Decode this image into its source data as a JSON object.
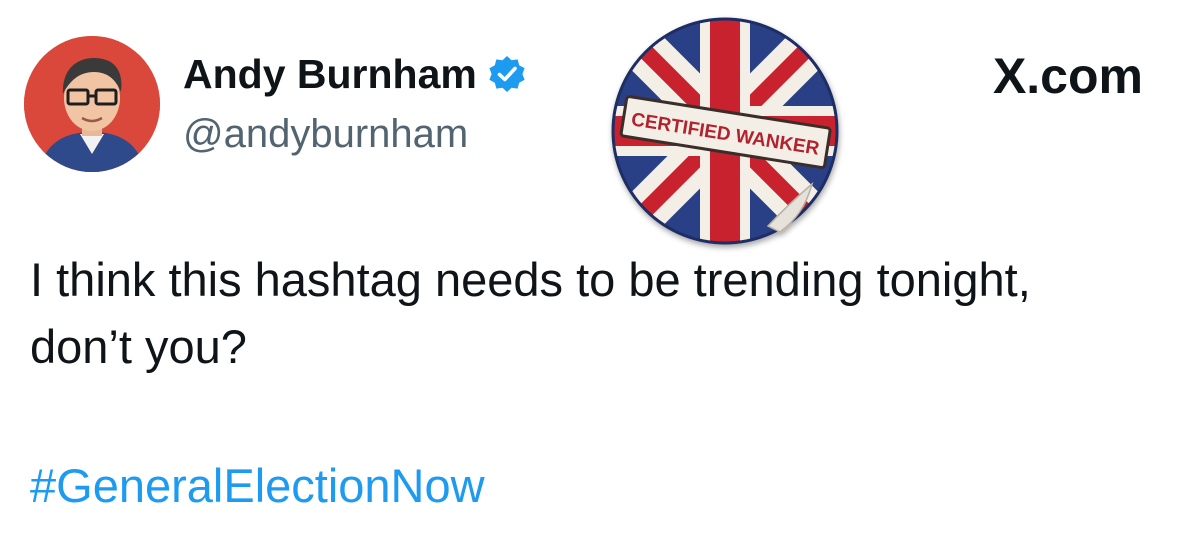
{
  "author": {
    "display_name": "Andy Burnham",
    "handle": "@andyburnham",
    "verified_icon": "verified-badge-icon"
  },
  "site_label": "X.com",
  "sticker": {
    "text": "CERTIFIED WANKER",
    "icon": "union-jack-sticker"
  },
  "tweet": {
    "line1": "I think this hashtag needs to be trending tonight,",
    "line2": "don’t you?",
    "hashtag": "#GeneralElectionNow"
  },
  "colors": {
    "text": "#0f1419",
    "secondary": "#536471",
    "link": "#1d9bf0",
    "verified": "#1d9bf0",
    "avatar_bg": "#d9483b"
  }
}
